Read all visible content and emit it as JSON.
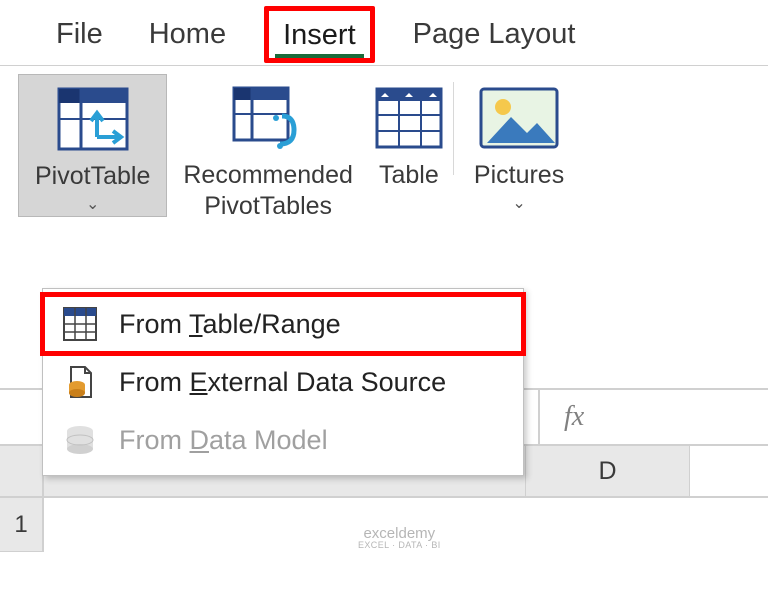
{
  "tabs": {
    "file": "File",
    "home": "Home",
    "insert": "Insert",
    "page_layout": "Page Layout"
  },
  "ribbon": {
    "pivot_table": "PivotTable",
    "recommended_line1": "Recommended",
    "recommended_line2": "PivotTables",
    "table": "Table",
    "pictures": "Pictures"
  },
  "menu": {
    "from_table_range_pre": "From ",
    "from_table_range_mn": "T",
    "from_table_range_post": "able/Range",
    "from_external_pre": "From ",
    "from_external_mn": "E",
    "from_external_post": "xternal Data Source",
    "from_data_model_pre": "From ",
    "from_data_model_mn": "D",
    "from_data_model_post": "ata Model"
  },
  "formula_bar": {
    "fx": "fx"
  },
  "grid": {
    "col_d": "D",
    "row_1": "1"
  },
  "watermark": {
    "title": "exceldemy",
    "sub": "EXCEL · DATA · BI"
  }
}
